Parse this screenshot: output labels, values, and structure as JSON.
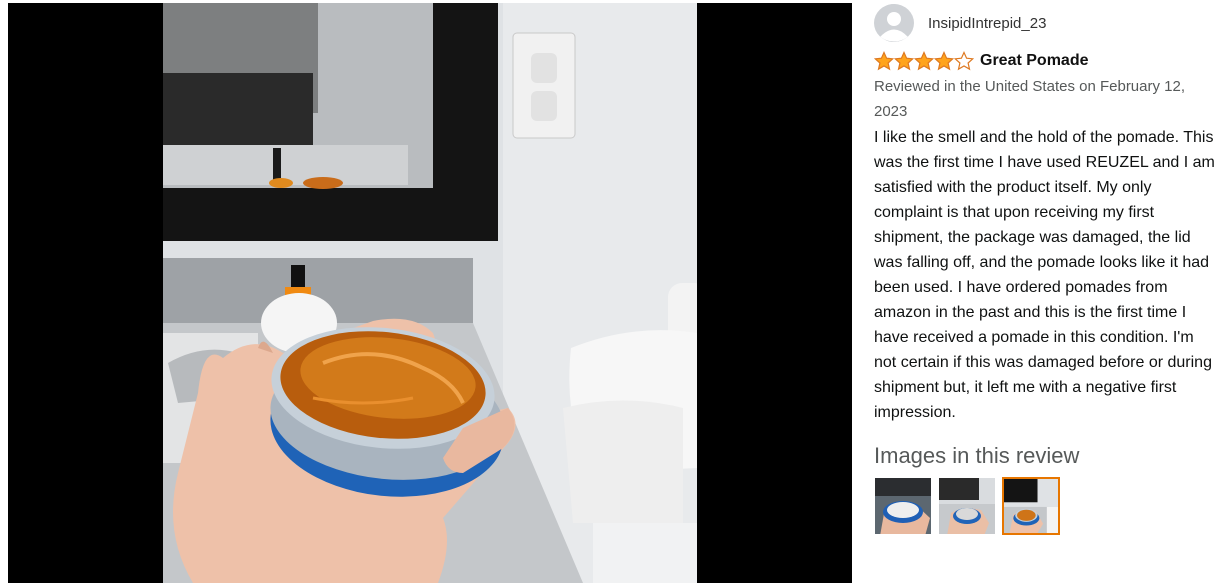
{
  "review": {
    "reviewer_name": "InsipidIntrepid_23",
    "rating": 4,
    "rating_max": 5,
    "title": "Great Pomade",
    "date_line": "Reviewed in the United States on February 12, 2023",
    "body": "I like the smell and the hold of the pomade. This was the first time I have used REUZEL and I am satisfied with the product itself. My only complaint is that upon receiving my first shipment, the package was damaged, the lid was falling off, and the pomade looks like it had been used. I have ordered pomades from amazon in the past and this is the first time I have received a pomade in this condition. I'm not certain if this was damaged before or during shipment but, it left me with a negative first impression."
  },
  "images_section": {
    "heading": "Images in this review",
    "thumbnails": [
      {
        "name": "thumbnail-1",
        "selected": false
      },
      {
        "name": "thumbnail-2",
        "selected": false
      },
      {
        "name": "thumbnail-3",
        "selected": true
      }
    ]
  },
  "colors": {
    "star_filled": "#ffa41c",
    "star_outline": "#de7921",
    "selected_border": "#e77600"
  },
  "icons": {
    "avatar": "user-avatar-icon",
    "star": "star-icon"
  }
}
